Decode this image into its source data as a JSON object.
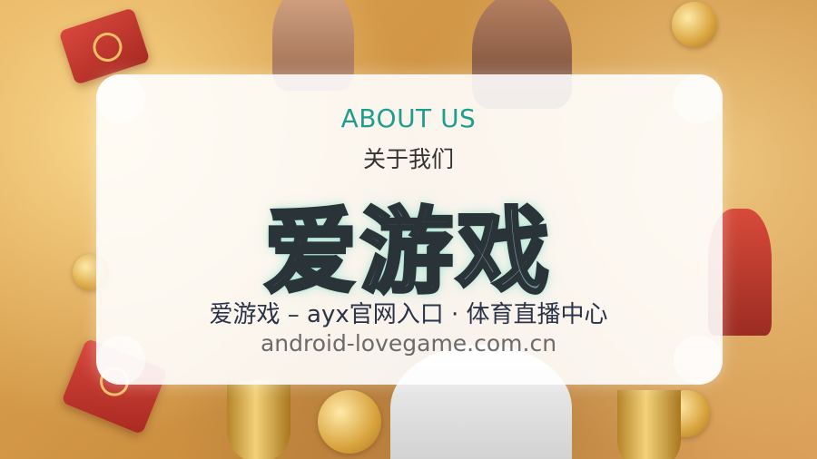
{
  "header": {
    "about_en": "ABOUT US",
    "about_cn": "关于我们"
  },
  "brand": {
    "name": "爱游戏"
  },
  "tagline": "爱游戏 – ayx官网入口 · 体育直播中心",
  "domain": "android-lovegame.com.cn",
  "colors": {
    "accent_teal": "#1f9e8e",
    "brand_fill": "#6e8f98",
    "brand_outline": "#2a3438",
    "background_gold": "#d29747"
  }
}
